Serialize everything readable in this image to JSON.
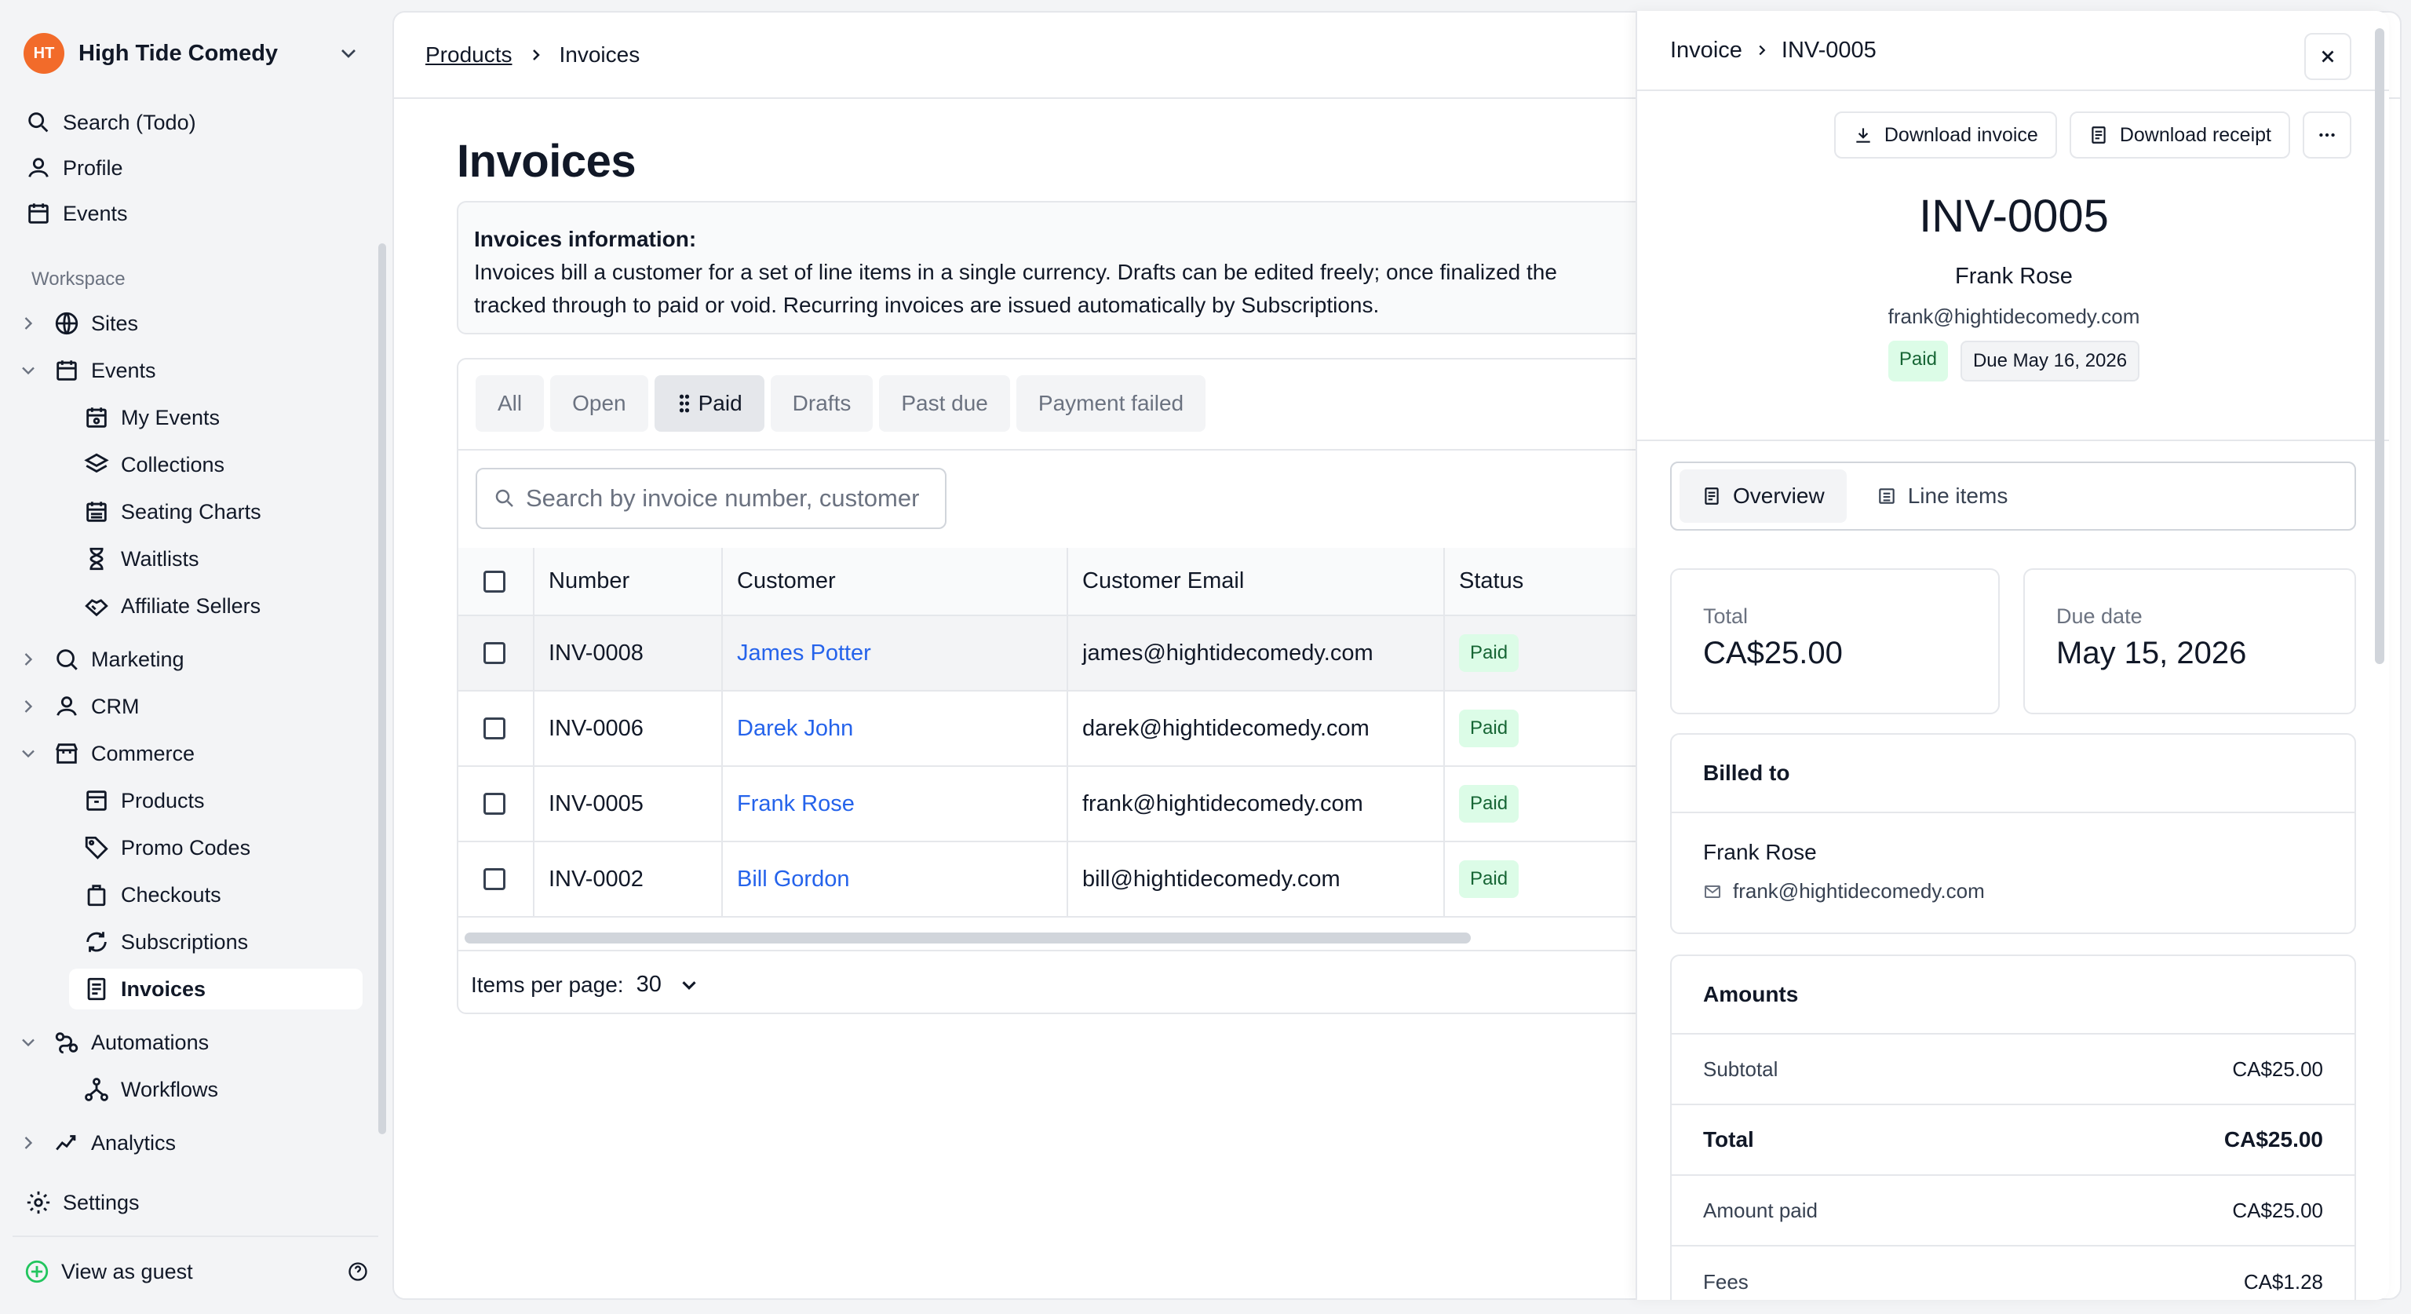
{
  "org": {
    "name": "High Tide Comedy",
    "logo_text": "HT"
  },
  "sidebar": {
    "top_items": [
      {
        "label": "Search (Todo)",
        "icon": "search-icon"
      },
      {
        "label": "Profile",
        "icon": "user-icon"
      },
      {
        "label": "Events",
        "icon": "calendar-icon"
      }
    ],
    "workspace_label": "Workspace",
    "items": [
      {
        "label": "Sites",
        "icon": "globe-icon"
      },
      {
        "label": "Events",
        "icon": "calendar-icon"
      },
      {
        "label": "My Events",
        "icon": "calendar-star-icon"
      },
      {
        "label": "Collections",
        "icon": "layers-icon"
      },
      {
        "label": "Seating Charts",
        "icon": "seating-icon"
      },
      {
        "label": "Waitlists",
        "icon": "hourglass-icon"
      },
      {
        "label": "Affiliate Sellers",
        "icon": "handshake-icon"
      },
      {
        "label": "Marketing",
        "icon": "megaphone-icon"
      },
      {
        "label": "CRM",
        "icon": "user-icon"
      },
      {
        "label": "Commerce",
        "icon": "store-icon"
      },
      {
        "label": "Products",
        "icon": "box-icon"
      },
      {
        "label": "Promo Codes",
        "icon": "tag-icon"
      },
      {
        "label": "Checkouts",
        "icon": "bag-icon"
      },
      {
        "label": "Subscriptions",
        "icon": "refresh-icon"
      },
      {
        "label": "Invoices",
        "icon": "receipt-icon"
      },
      {
        "label": "Automations",
        "icon": "workflow-icon"
      },
      {
        "label": "Workflows",
        "icon": "nodes-icon"
      },
      {
        "label": "Analytics",
        "icon": "chart-icon"
      }
    ],
    "settings_label": "Settings",
    "guest_label": "View as guest"
  },
  "breadcrumb": {
    "parent": "Products",
    "current": "Invoices"
  },
  "page": {
    "title": "Invoices",
    "info_title": "Invoices information:",
    "info_line1": "Invoices bill a customer for a set of line items in a single currency. Drafts can be edited freely; once finalized the",
    "info_line2": "tracked through to paid or void. Recurring invoices are issued automatically by Subscriptions."
  },
  "tabs": [
    "All",
    "Open",
    "Paid",
    "Drafts",
    "Past due",
    "Payment failed"
  ],
  "search": {
    "placeholder": "Search by invoice number, customer"
  },
  "table": {
    "headers": [
      "Number",
      "Customer",
      "Customer Email",
      "Status"
    ],
    "rows": [
      {
        "number": "INV-0008",
        "customer": "James Potter",
        "email": "james@hightidecomedy.com",
        "status": "Paid"
      },
      {
        "number": "INV-0006",
        "customer": "Darek John",
        "email": "darek@hightidecomedy.com",
        "status": "Paid"
      },
      {
        "number": "INV-0005",
        "customer": "Frank Rose",
        "email": "frank@hightidecomedy.com",
        "status": "Paid"
      },
      {
        "number": "INV-0002",
        "customer": "Bill Gordon",
        "email": "bill@hightidecomedy.com",
        "status": "Paid"
      }
    ]
  },
  "pager": {
    "label": "Items per page:",
    "value": "30"
  },
  "drawer": {
    "crumb_parent": "Invoice",
    "crumb_current": "INV-0005",
    "download_invoice": "Download invoice",
    "download_receipt": "Download receipt",
    "number": "INV-0005",
    "customer_name": "Frank Rose",
    "customer_email": "frank@hightidecomedy.com",
    "status": "Paid",
    "due_chip": "Due May 16, 2026",
    "tab_overview": "Overview",
    "tab_line_items": "Line items",
    "total_label": "Total",
    "total_value": "CA$25.00",
    "due_label": "Due date",
    "due_value": "May 15, 2026",
    "billed_to_title": "Billed to",
    "billed_name": "Frank Rose",
    "billed_email": "frank@hightidecomedy.com",
    "amounts_title": "Amounts",
    "amounts": [
      {
        "label": "Subtotal",
        "value": "CA$25.00"
      },
      {
        "label": "Total",
        "value": "CA$25.00"
      },
      {
        "label": "Amount paid",
        "value": "CA$25.00"
      },
      {
        "label": "Fees",
        "value": "CA$1.28"
      }
    ]
  },
  "colors": {
    "accent": "#2563eb",
    "brand": "#f26b2a",
    "paid_bg": "#dcfce7",
    "paid_fg": "#166534"
  }
}
